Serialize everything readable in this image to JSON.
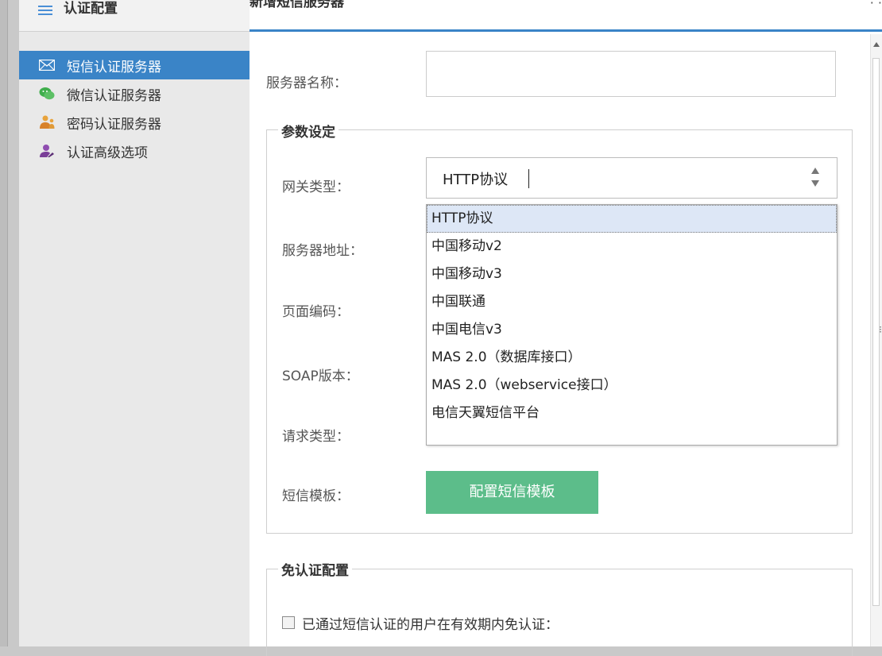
{
  "sidebar": {
    "header": "认证配置",
    "items": [
      {
        "label": "短信认证服务器",
        "icon": "envelope-icon",
        "active": true
      },
      {
        "label": "微信认证服务器",
        "icon": "wechat-icon",
        "active": false
      },
      {
        "label": "密码认证服务器",
        "icon": "users-icon",
        "active": false
      },
      {
        "label": "认证高级选项",
        "icon": "user-settings-icon",
        "active": false
      }
    ]
  },
  "dialog": {
    "title": "新增短信服务器",
    "dots": "· ·"
  },
  "form": {
    "server_name_label": "服务器名称：",
    "server_name_value": "",
    "param_legend": "参数设定",
    "gateway_label": "网关类型：",
    "gateway_value": "HTTP协议",
    "server_address_label": "服务器地址：",
    "page_encoding_label": "页面编码：",
    "soap_label": "SOAP版本：",
    "request_type_label": "请求类型：",
    "sms_template_label": "短信模板：",
    "sms_template_button": "配置短信模板",
    "exempt_legend": "免认证配置",
    "exempt_checkbox_label": "已通过短信认证的用户在有效期内免认证：",
    "exempt_checked": false
  },
  "gateway_options": [
    "HTTP协议",
    "中国移动v2",
    "中国移动v3",
    "中国联通",
    "中国电信v3",
    "MAS 2.0（数据库接口）",
    "MAS 2.0（webservice接口）",
    "电信天翼短信平台"
  ],
  "colors": {
    "accent": "#3a84c7",
    "button": "#5cbd8a",
    "highlight": "#dde7f6"
  }
}
